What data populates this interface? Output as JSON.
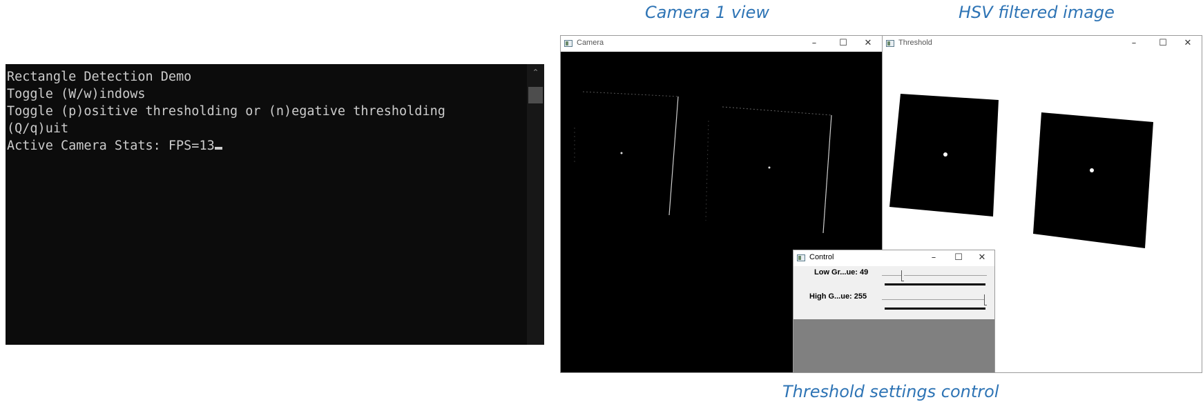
{
  "captions": {
    "camera": "Camera 1 view",
    "threshold": "HSV filtered image",
    "control": "Threshold settings control"
  },
  "console": {
    "lines": [
      "Rectangle Detection Demo",
      "Toggle (W/w)indows",
      "Toggle (p)ositive thresholding or (n)egative thresholding",
      "(Q/q)uit",
      "Active Camera Stats: FPS=13"
    ]
  },
  "windows": {
    "camera": {
      "title": "Camera"
    },
    "threshold": {
      "title": "Threshold"
    },
    "control": {
      "title": "Control",
      "sliders": [
        {
          "label": "Low Gr...ue: 49",
          "value": 49,
          "max": 255
        },
        {
          "label": "High G...ue: 255",
          "value": 255,
          "max": 255
        }
      ]
    }
  },
  "icons": {
    "minimize": "minimize-icon",
    "maximize": "maximize-icon",
    "close": "close-icon"
  },
  "colors": {
    "caption": "#2e74b5",
    "console_bg": "#0c0c0c",
    "console_text": "#cccccc",
    "control_bg": "#808080"
  }
}
